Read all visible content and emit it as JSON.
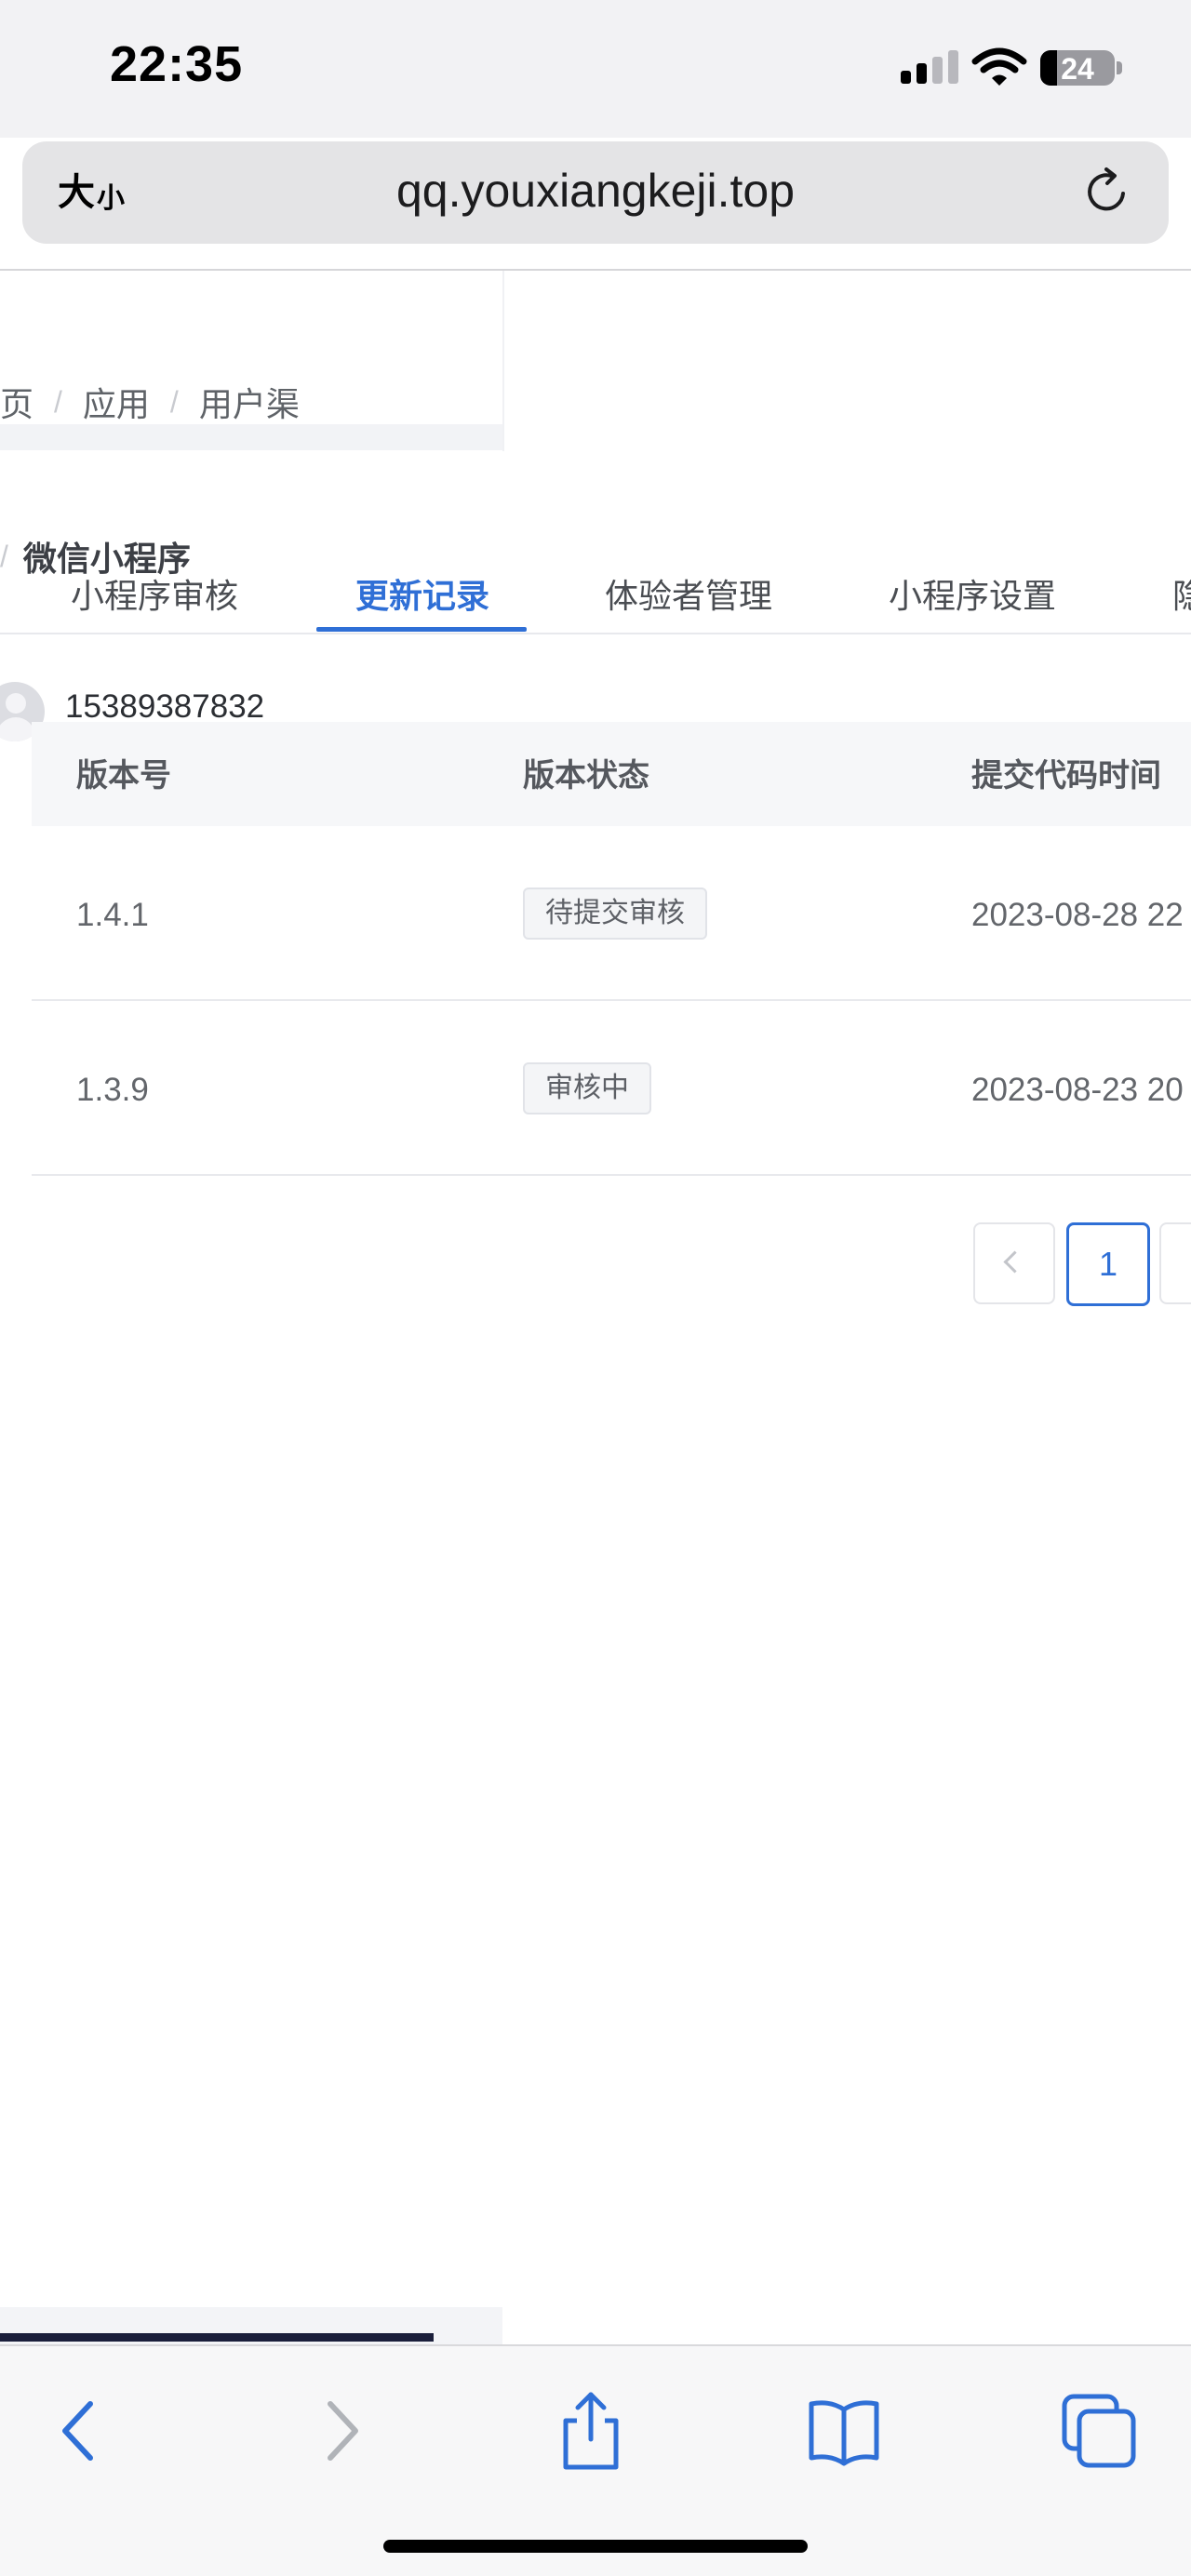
{
  "status_bar": {
    "time": "22:35",
    "battery_level": "24"
  },
  "browser": {
    "text_size_label_big": "大",
    "text_size_label_small": "小",
    "url": "qq.youxiangkeji.top"
  },
  "breadcrumb": {
    "items": [
      "页",
      "应用",
      "用户渠"
    ]
  },
  "app_header": {
    "back_fragment": "",
    "title": "微信小程序"
  },
  "tabs": [
    {
      "label": "小程序审核",
      "active": false
    },
    {
      "label": "更新记录",
      "active": true
    },
    {
      "label": "体验者管理",
      "active": false
    },
    {
      "label": "小程序设置",
      "active": false
    },
    {
      "label": "隐",
      "active": false
    }
  ],
  "user": {
    "phone": "15389387832"
  },
  "table": {
    "columns": [
      "版本号",
      "版本状态",
      "提交代码时间"
    ],
    "rows": [
      {
        "version": "1.4.1",
        "status": "待提交审核",
        "submitted_at": "2023-08-28 22"
      },
      {
        "version": "1.3.9",
        "status": "审核中",
        "submitted_at": "2023-08-23 20"
      }
    ]
  },
  "pagination": {
    "current_page": "1"
  },
  "colors": {
    "accent": "#2f6fd6",
    "text": "#4a4d52",
    "header_bg": "#f6f7f9"
  }
}
